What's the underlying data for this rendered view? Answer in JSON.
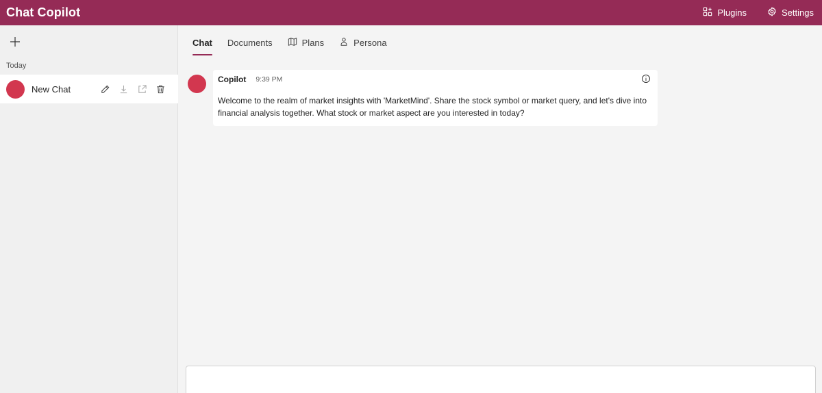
{
  "header": {
    "title": "Chat Copilot",
    "plugins_label": "Plugins",
    "settings_label": "Settings"
  },
  "sidebar": {
    "section_label": "Today",
    "chats": [
      {
        "title": "New Chat"
      }
    ]
  },
  "tabs": [
    {
      "label": "Chat",
      "active": true
    },
    {
      "label": "Documents"
    },
    {
      "label": "Plans",
      "icon": "map-icon"
    },
    {
      "label": "Persona",
      "icon": "person-icon"
    }
  ],
  "messages": [
    {
      "author": "Copilot",
      "time": "9:39 PM",
      "text": "Welcome to the realm of market insights with 'MarketMind'. Share the stock symbol or market query, and let's dive into financial analysis together. What stock or market aspect are you interested in today?"
    }
  ],
  "colors": {
    "brand": "#952b56",
    "avatar": "#d2374f"
  }
}
